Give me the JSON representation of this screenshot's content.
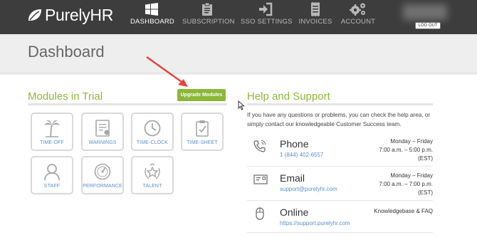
{
  "brand": {
    "name": "PurelyHR"
  },
  "nav": {
    "items": [
      {
        "label": "DASHBOARD",
        "icon": "windows-icon",
        "active": true
      },
      {
        "label": "SUBSCRIPTION",
        "icon": "clipboard-icon",
        "active": false
      },
      {
        "label": "SSO SETTINGS",
        "icon": "sign-in-icon",
        "active": false
      },
      {
        "label": "INVOICES",
        "icon": "receipt-icon",
        "active": false
      },
      {
        "label": "ACCOUNT",
        "icon": "gears-icon",
        "active": false
      }
    ],
    "logout_label": "LOG OUT"
  },
  "page": {
    "title": "Dashboard"
  },
  "modules": {
    "heading": "Modules in Trial",
    "upgrade_label": "Upgrade Modules",
    "tiles": [
      {
        "label": "TIME-OFF",
        "icon": "palm-tree-icon"
      },
      {
        "label": "WARNINGS",
        "icon": "warning-document-icon"
      },
      {
        "label": "TIME-CLOCK",
        "icon": "clock-icon"
      },
      {
        "label": "TIME-SHEET",
        "icon": "timesheet-clipboard-icon"
      },
      {
        "label": "STAFF",
        "icon": "staff-person-icon"
      },
      {
        "label": "PERFORMANCE",
        "icon": "gauge-icon"
      },
      {
        "label": "TALENT",
        "icon": "star-laurel-icon"
      }
    ]
  },
  "help": {
    "heading": "Help and Support",
    "intro": "If you have any questions or problems, you can check the help area, or simply contact our knowledgeable Customer Success team.",
    "contacts": [
      {
        "title": "Phone",
        "link": "1 (844) 402-6557",
        "icon": "phone-icon",
        "hours": [
          "Monday – Friday",
          "7:00 a.m. – 5:00 p.m.",
          "(EST)"
        ]
      },
      {
        "title": "Email",
        "link": "support@purelyhr.com",
        "icon": "envelope-icon",
        "hours": [
          "Monday – Friday",
          "7:00 a.m. – 7:00 p.m.",
          "(EST)"
        ]
      },
      {
        "title": "Online",
        "link": "https://support.purelyhr.com",
        "icon": "mouse-icon",
        "hours": [
          "Knowledgebase & FAQ"
        ]
      }
    ]
  },
  "colors": {
    "accent": "#8cb739",
    "link": "#5b8fc7",
    "topbar": "#3d3d3d",
    "arrow": "#e0463b"
  }
}
